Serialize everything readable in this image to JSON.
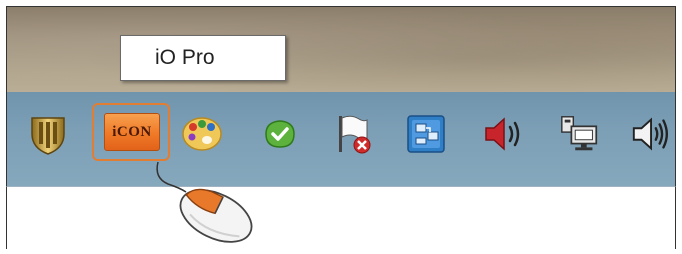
{
  "tooltip": {
    "text": "iO Pro"
  },
  "tray": {
    "icons": [
      {
        "name": "security-shield-icon",
        "color": "#c9a43c"
      },
      {
        "name": "icon-io-pro-icon",
        "label": "iCON",
        "color": "#ef7a27"
      },
      {
        "name": "color-palette-icon",
        "color": "#e9c54a"
      },
      {
        "name": "green-check-icon",
        "color": "#57a93a"
      },
      {
        "name": "action-center-flag-icon",
        "color": "#d02b2b"
      },
      {
        "name": "network-adapter-icon",
        "color": "#2f7fc6"
      },
      {
        "name": "volume-muted-icon",
        "color": "#c21f25"
      },
      {
        "name": "network-computer-icon",
        "color": "#3a3a3a"
      },
      {
        "name": "volume-speaker-icon",
        "color": "#3a3a3a"
      }
    ]
  },
  "pointer": {
    "name": "mouse-illustration",
    "accent_color": "#e8792a"
  }
}
